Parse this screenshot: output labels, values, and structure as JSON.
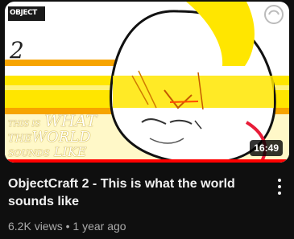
{
  "video": {
    "title": "ObjectCraft 2 - This is what the world sounds like",
    "views": "6.2K views",
    "separator": "•",
    "age": "1 year ago",
    "duration": "16:49",
    "watched_fraction": 1.0
  },
  "thumbnail": {
    "number_text": "2",
    "caption_line1": "THIS IS",
    "caption_word1": "WHAT",
    "caption_line2": "THE",
    "caption_word2": "WORLD",
    "caption_line3": "SOUNDS",
    "caption_word3": "LIKE",
    "channel_logo_text": "OBJECT"
  },
  "colors": {
    "accent_yellow": "#ffe600",
    "orange": "#f7a400",
    "progress": "#ff0000"
  },
  "icons": {
    "more": "kebab-vertical-icon"
  }
}
